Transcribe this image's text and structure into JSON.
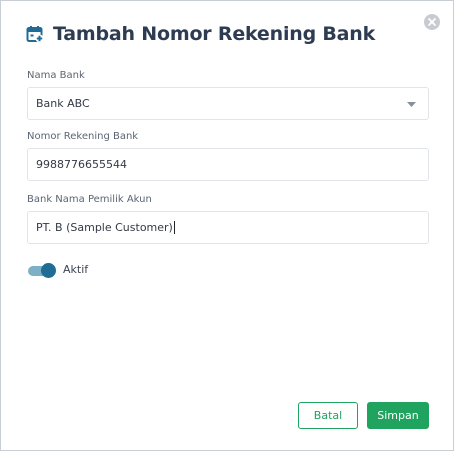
{
  "dialog": {
    "title": "Tambah Nomor Rekening Bank",
    "title_icon": "calendar-add-icon",
    "close_icon": "close-icon"
  },
  "form": {
    "bank_name": {
      "label": "Nama Bank",
      "value": "Bank ABC",
      "icon": "chevron-down-icon"
    },
    "account_number": {
      "label": "Nomor Rekening Bank",
      "value": "9988776655544"
    },
    "account_holder": {
      "label": "Bank Nama Pemilik Akun",
      "value": "PT. B (Sample Customer)"
    },
    "active": {
      "label": "Aktif",
      "enabled": true
    }
  },
  "actions": {
    "cancel_label": "Batal",
    "save_label": "Simpan"
  },
  "colors": {
    "title": "#2e3c52",
    "accent_blue": "#1f6d94",
    "primary_green": "#1fa35f",
    "toggle_track": "#7dafc6",
    "close_bg": "#c7cbd1"
  }
}
